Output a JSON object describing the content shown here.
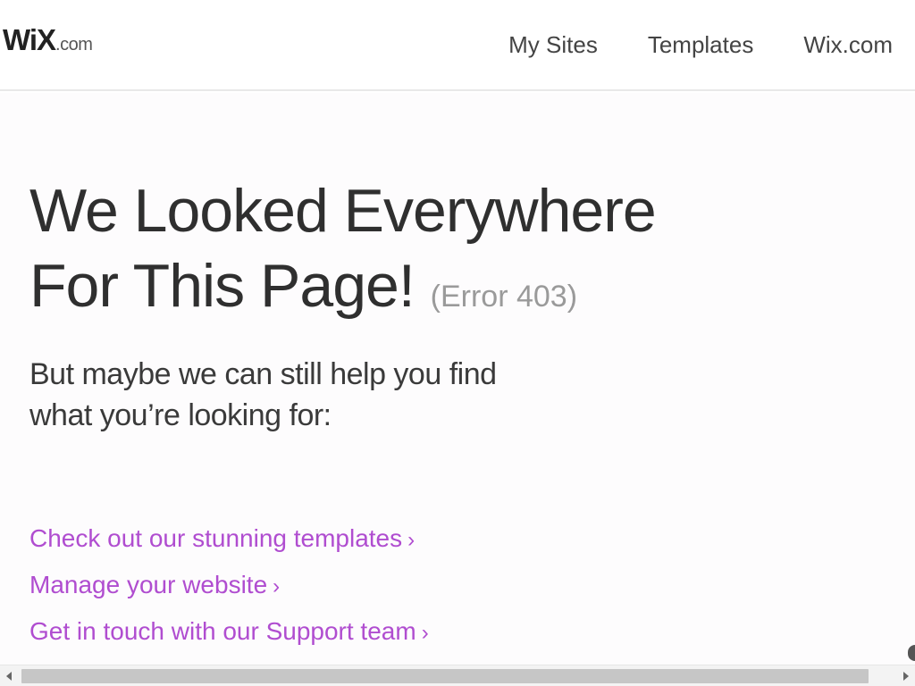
{
  "header": {
    "logo": {
      "main": "WiX",
      "suffix": ".com"
    },
    "nav": [
      {
        "label": "My Sites"
      },
      {
        "label": "Templates"
      },
      {
        "label": "Wix.com"
      }
    ]
  },
  "main": {
    "title_line1": "We Looked Everywhere",
    "title_line2": "For This Page!",
    "error_code": "(Error 403)",
    "subtitle_line1": "But maybe we can still help you find",
    "subtitle_line2": "what you’re looking for:",
    "links": [
      {
        "label": "Check out our stunning templates",
        "chevron": "›"
      },
      {
        "label": "Manage your website",
        "chevron": "›"
      },
      {
        "label": "Get in touch with our Support team",
        "chevron": "›"
      }
    ]
  },
  "colors": {
    "link": "#b04dd0",
    "title": "#2f2f2f",
    "error_code": "#9a9a9a",
    "nav": "#444444"
  },
  "scrollbar": {
    "left_arrow_icon": "triangle-left-icon",
    "right_arrow_icon": "triangle-right-icon"
  }
}
